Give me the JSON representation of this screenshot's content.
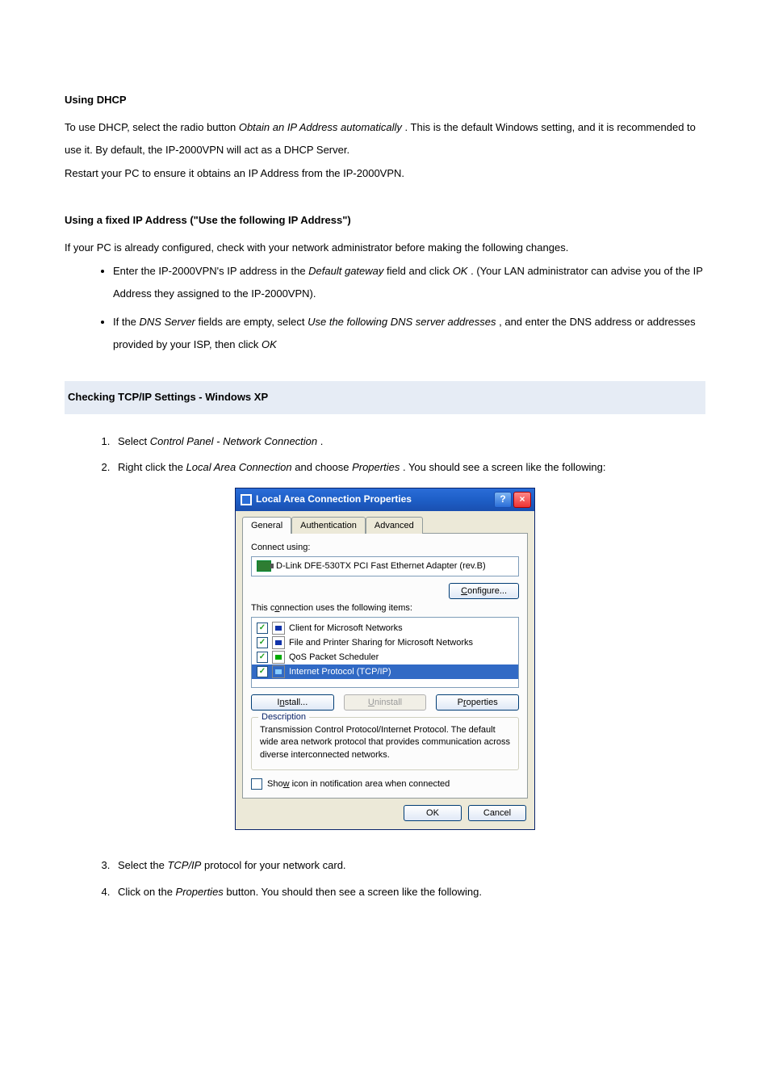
{
  "doc": {
    "dhcp_heading": "Using DHCP",
    "dhcp_p1a": "To use DHCP, select the radio button ",
    "dhcp_p1_italic": "Obtain an IP Address automatically",
    "dhcp_p1b": ". This is the default Windows setting, and it is recommended to use it. By default, the IP-2000VPN will act as a DHCP Server.",
    "dhcp_p2": "Restart your PC to ensure it obtains an IP Address from the IP-2000VPN.",
    "fixed_heading": "Using a fixed IP Address (\"Use the following IP Address\")",
    "fixed_intro": "If your PC is already configured, check with your network administrator before making the following changes.",
    "fixed_b1a": "Enter the IP-2000VPN's IP address in the ",
    "fixed_b1_italic": "Default gateway",
    "fixed_b1b": " field and click ",
    "fixed_b1_italic2": "OK",
    "fixed_b1c": ". (Your LAN administrator can advise you of the IP Address they assigned to the IP-2000VPN).",
    "fixed_b2a": "If the ",
    "fixed_b2_italic": "DNS Server",
    "fixed_b2b": " fields are empty, select ",
    "fixed_b2_italic2": "Use the following DNS server addresses",
    "fixed_b2c": ", and enter the DNS address or addresses provided by your ISP, then click ",
    "fixed_b2_italic3": "OK",
    "xp_heading": "Checking TCP/IP Settings - Windows XP",
    "step1a": "Select ",
    "step1_italic": "Control Panel - Network Connection",
    "step1b": ".",
    "step2a": "Right click the ",
    "step2_italic": "Local Area Connection",
    "step2b": " and choose ",
    "step2_italic2": "Properties",
    "step2c": ". You should see a screen like the following:",
    "step3a": "Select the ",
    "step3_italic": "TCP/IP",
    "step3b": " protocol for your network card.",
    "step4a": "Click on the ",
    "step4_italic": "Properties",
    "step4b": " button. You should then see a screen like the following."
  },
  "dialog": {
    "title": "Local Area Connection Properties",
    "tabs": {
      "general": "General",
      "auth": "Authentication",
      "advanced": "Advanced"
    },
    "connect_using_label": "Connect using:",
    "adapter": "D-Link DFE-530TX PCI Fast Ethernet Adapter (rev.B)",
    "configure_btn": "Configure...",
    "items_label": "This connection uses the following items:",
    "items": [
      "Client for Microsoft Networks",
      "File and Printer Sharing for Microsoft Networks",
      "QoS Packet Scheduler",
      "Internet Protocol (TCP/IP)"
    ],
    "install_btn": "Install...",
    "uninstall_btn": "Uninstall",
    "properties_btn": "Properties",
    "desc_title": "Description",
    "desc_text": "Transmission Control Protocol/Internet Protocol. The default wide area network protocol that provides communication across diverse interconnected networks.",
    "show_icon_label": "Show icon in notification area when connected",
    "ok": "OK",
    "cancel": "Cancel"
  }
}
